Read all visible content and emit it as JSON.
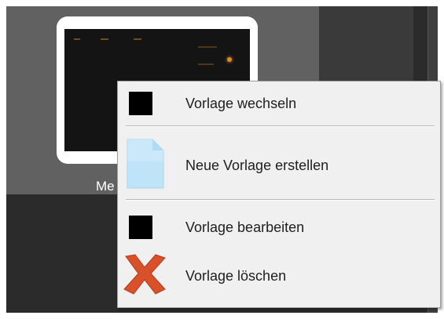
{
  "gallery": {
    "tile_caption": "Me"
  },
  "menu": {
    "items": [
      {
        "label": "Vorlage wechseln",
        "icon": "black-square-icon"
      },
      {
        "label": "Neue Vorlage erstellen",
        "icon": "new-document-icon"
      },
      {
        "label": "Vorlage bearbeiten",
        "icon": "black-square-icon"
      },
      {
        "label": "Vorlage löschen",
        "icon": "red-x-delete-icon"
      }
    ]
  },
  "colors": {
    "menu_bg": "#f0f0f0",
    "delete_icon": "#d9512b",
    "doc_icon": "#bfe3f7",
    "app_bg": "#2b2b2b"
  }
}
